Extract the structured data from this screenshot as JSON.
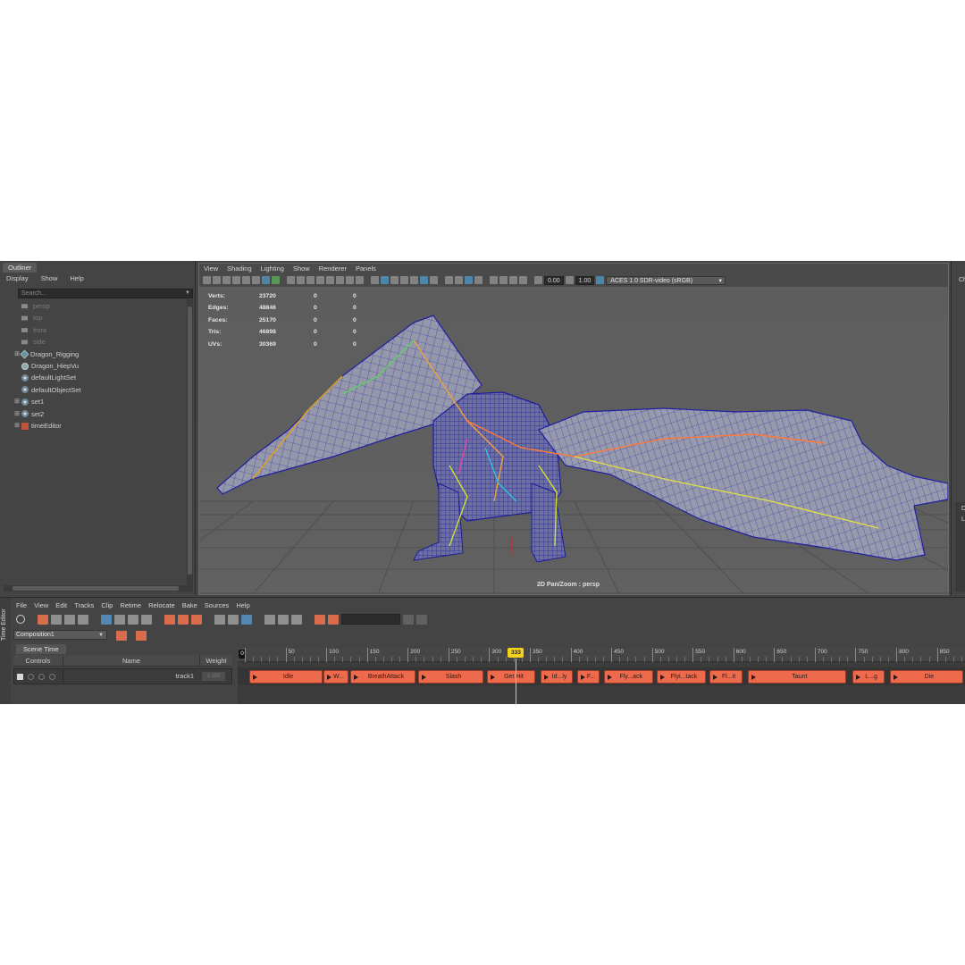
{
  "outliner": {
    "title": "Outliner",
    "menu": [
      "Display",
      "Show",
      "Help"
    ],
    "search_placeholder": "Search...",
    "items": [
      {
        "label": "persp",
        "icon": "camera-icon",
        "expandable": false,
        "dim": true
      },
      {
        "label": "top",
        "icon": "camera-icon",
        "expandable": false,
        "dim": true
      },
      {
        "label": "front",
        "icon": "camera-icon",
        "expandable": false,
        "dim": true
      },
      {
        "label": "side",
        "icon": "camera-icon",
        "expandable": false,
        "dim": true
      },
      {
        "label": "Dragon_Rigging",
        "icon": "joint-icon",
        "expandable": true,
        "dim": false
      },
      {
        "label": "Dragon_HiepVu",
        "icon": "mesh-icon",
        "expandable": false,
        "dim": false
      },
      {
        "label": "defaultLightSet",
        "icon": "set-icon",
        "expandable": false,
        "dim": false
      },
      {
        "label": "defaultObjectSet",
        "icon": "set-icon",
        "expandable": false,
        "dim": false
      },
      {
        "label": "set1",
        "icon": "set-icon",
        "expandable": true,
        "dim": false
      },
      {
        "label": "set2",
        "icon": "set-icon",
        "expandable": true,
        "dim": false
      },
      {
        "label": "timeEditor",
        "icon": "time-editor-icon",
        "expandable": true,
        "dim": false
      }
    ]
  },
  "viewport": {
    "menu": [
      "View",
      "Shading",
      "Lighting",
      "Show",
      "Renderer",
      "Panels"
    ],
    "exposure": "0.00",
    "gamma": "1.00",
    "color_space": "ACES 1.0 SDR-video (sRGB)",
    "hud": [
      {
        "label": "Verts:",
        "value": "23720",
        "a": "0",
        "b": "0"
      },
      {
        "label": "Edges:",
        "value": "48846",
        "a": "0",
        "b": "0"
      },
      {
        "label": "Faces:",
        "value": "25170",
        "a": "0",
        "b": "0"
      },
      {
        "label": "Tris:",
        "value": "46898",
        "a": "0",
        "b": "0"
      },
      {
        "label": "UVs:",
        "value": "30369",
        "a": "0",
        "b": "0"
      }
    ],
    "camera_label": "2D Pan/Zoom : persp"
  },
  "side_panel": {
    "label_top": "Ch",
    "label_mid": "D",
    "label_mid2": "L"
  },
  "time_editor": {
    "side_title": "Time Editor",
    "menu": [
      "File",
      "View",
      "Edit",
      "Tracks",
      "Clip",
      "Retime",
      "Relocate",
      "Bake",
      "Sources",
      "Help"
    ],
    "composition": "Composition1",
    "scene_tab": "Scene Time",
    "columns": {
      "controls": "Controls",
      "name": "Name",
      "weight": "Weight"
    },
    "track": {
      "name": "track1",
      "weight": "1.000"
    },
    "timeline": {
      "start": "0",
      "range": [
        0,
        880
      ],
      "tick_step": 50,
      "tick_labels": [
        "0",
        "50",
        "100",
        "150",
        "200",
        "250",
        "300",
        "350",
        "400",
        "450",
        "500",
        "550",
        "600",
        "650",
        "700",
        "750",
        "800",
        "850"
      ],
      "current_frame": 333,
      "current_frame_label": "333"
    },
    "clips": [
      {
        "label": "Idle",
        "start": 5,
        "end": 95
      },
      {
        "label": "W...",
        "start": 97,
        "end": 127
      },
      {
        "label": "BreathAttack",
        "start": 130,
        "end": 210
      },
      {
        "label": "Slash",
        "start": 213,
        "end": 293
      },
      {
        "label": "Get Hit",
        "start": 297,
        "end": 357
      },
      {
        "label": "Id...ly",
        "start": 363,
        "end": 403
      },
      {
        "label": "F...",
        "start": 408,
        "end": 436
      },
      {
        "label": "Fly...ack",
        "start": 441,
        "end": 501
      },
      {
        "label": "Flyi...tack",
        "start": 506,
        "end": 566
      },
      {
        "label": "Fl...it",
        "start": 571,
        "end": 611
      },
      {
        "label": "Taunt",
        "start": 618,
        "end": 738
      },
      {
        "label": "L...g",
        "start": 746,
        "end": 786
      },
      {
        "label": "Die",
        "start": 792,
        "end": 902
      }
    ]
  },
  "colors": {
    "clip": "#ee6a4c",
    "playhead": "#f5d11b",
    "wireframe": "#2a2aa8",
    "mesh": "#8d8fa6"
  }
}
